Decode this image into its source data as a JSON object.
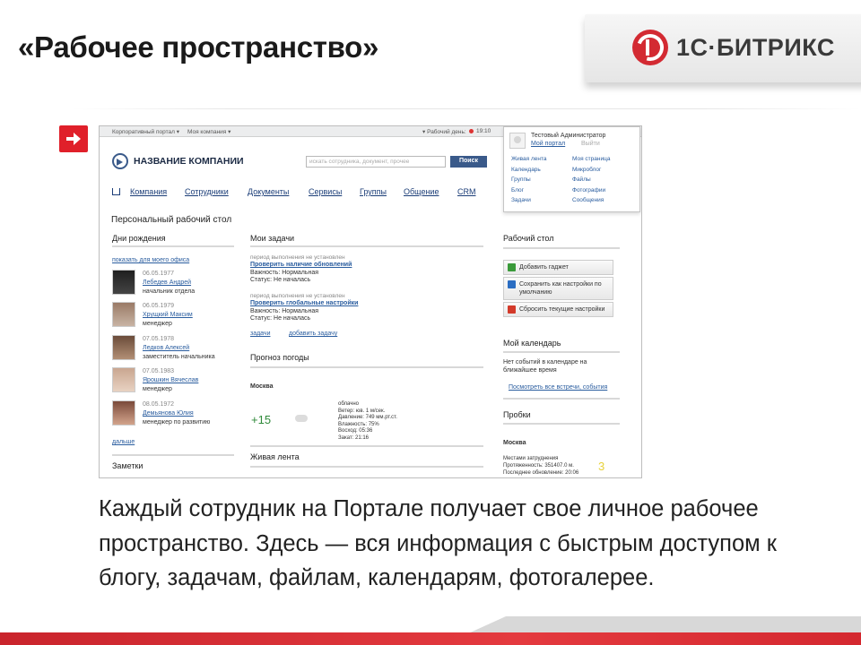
{
  "slide": {
    "title": "«Рабочее пространство»",
    "brand": "1С·БИТРИКС",
    "body": "Каждый сотрудник на Портале получает свое личное рабочее пространство. Здесь — вся информация с быстрым доступом к блогу, задачам, файлам, календарям, фотогалерее."
  },
  "colors": {
    "accent_red": "#e0202a",
    "portal_blue": "#2a5d9f",
    "brand_gray": "#3a3a3a"
  },
  "portal": {
    "topbar": {
      "corp_portal": "Корпоративный портал ▾",
      "my_company": "Моя компания ▾",
      "workday": "▾ Рабочий день:",
      "time": "19:10"
    },
    "company_name": "НАЗВАНИЕ КОМПАНИИ",
    "search_placeholder": "искать сотрудника, документ, прочее",
    "search_button": "Поиск",
    "user": {
      "name": "Тестовый Администратор",
      "my_portal": "Мой портал",
      "logout": "Выйти",
      "links_left": [
        "Живая лента",
        "Календарь",
        "Группы",
        "Блог",
        "Задачи"
      ],
      "links_right": [
        "Моя страница",
        "Микроблог",
        "Файлы",
        "Фотографии",
        "Сообщения"
      ]
    },
    "menu": [
      "Компания",
      "Сотрудники",
      "Документы",
      "Сервисы",
      "Группы",
      "Общение",
      "CRM"
    ],
    "page_title": "Персональный рабочий стол",
    "birthdays": {
      "header": "Дни рождения",
      "show_office": "показать для моего офиса",
      "people": [
        {
          "date": "06.05.1977",
          "name": "Лебедев Андрей",
          "role": "начальник отдела"
        },
        {
          "date": "06.05.1979",
          "name": "Хрущкий Максим",
          "role": "менеджер"
        },
        {
          "date": "07.05.1978",
          "name": "Ледков Алексей",
          "role": "заместитель начальника"
        },
        {
          "date": "07.05.1983",
          "name": "Ярошкин Вячеслав",
          "role": "менеджер"
        },
        {
          "date": "08.05.1972",
          "name": "Демьянова Юлия",
          "role": "менеджер по развитию"
        }
      ],
      "more": "дальше"
    },
    "notes_header": "Заметки",
    "tasks": {
      "header": "Мои задачи",
      "items": [
        {
          "period": "период выполнения не установлен",
          "title": "Проверить наличие обновлений",
          "importance": "Важность: Нормальная",
          "status": "Статус: Не началась"
        },
        {
          "period": "период выполнения не установлен",
          "title": "Проверить глобальные настройки",
          "importance": "Важность: Нормальная",
          "status": "Статус: Не началась"
        }
      ],
      "link_tasks": "задачи",
      "link_add": "добавить задачу"
    },
    "weather": {
      "header": "Прогноз погоды",
      "city": "Москва",
      "temperature": "+15",
      "details": [
        "облачно",
        "Ветер: юв. 1 м/сек.",
        "Давление: 749 мм.рт.ст.",
        "Влажность: 75%",
        "Восход: 05:36",
        "Закат: 21:16"
      ]
    },
    "feed_header": "Живая лента",
    "desktop": {
      "header": "Рабочий стол",
      "buttons": [
        "Добавить гаджет",
        "Сохранить как настройки по умолчанию",
        "Сбросить текущие настройки"
      ]
    },
    "calendar": {
      "header": "Мой календарь",
      "empty": "Нет событий в календаре на ближайшее время",
      "link": "Посмотреть все встречи, события"
    },
    "traffic": {
      "header": "Пробки",
      "city": "Москва",
      "lines": [
        "Местами затруднения",
        "Протяженность: 351407.0 м.",
        "Последнее обновление: 20:06"
      ],
      "level": "3"
    }
  }
}
